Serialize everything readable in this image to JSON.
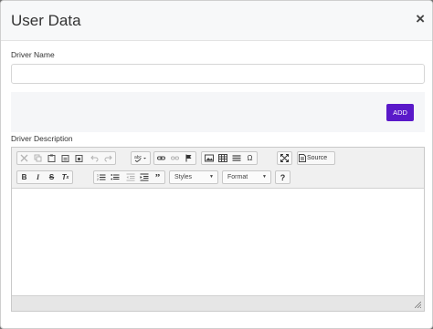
{
  "modal": {
    "title": "User Data",
    "close_label": "×"
  },
  "form": {
    "driver_name_label": "Driver Name",
    "driver_name_value": "",
    "add_button_label": "ADD",
    "driver_description_label": "Driver Description"
  },
  "editor": {
    "source_label": "Source",
    "styles_label": "Styles",
    "format_label": "Format",
    "toolbar_row1": [
      "cut-icon",
      "copy-icon",
      "paste-icon",
      "paste-text-icon",
      "paste-word-icon",
      "undo-icon",
      "redo-icon",
      "spellcheck-icon",
      "link-icon",
      "unlink-icon",
      "anchor-icon",
      "image-icon",
      "table-icon",
      "horizontal-rule-icon",
      "special-char-icon",
      "maximize-icon",
      "source-icon"
    ],
    "toolbar_row2": [
      "bold-icon",
      "italic-icon",
      "strike-icon",
      "remove-format-icon",
      "numbered-list-icon",
      "bulleted-list-icon",
      "outdent-icon",
      "indent-icon",
      "blockquote-icon",
      "help-icon"
    ],
    "content": ""
  },
  "colors": {
    "accent": "#5a19c9",
    "backdrop": "#6f6f6f"
  }
}
